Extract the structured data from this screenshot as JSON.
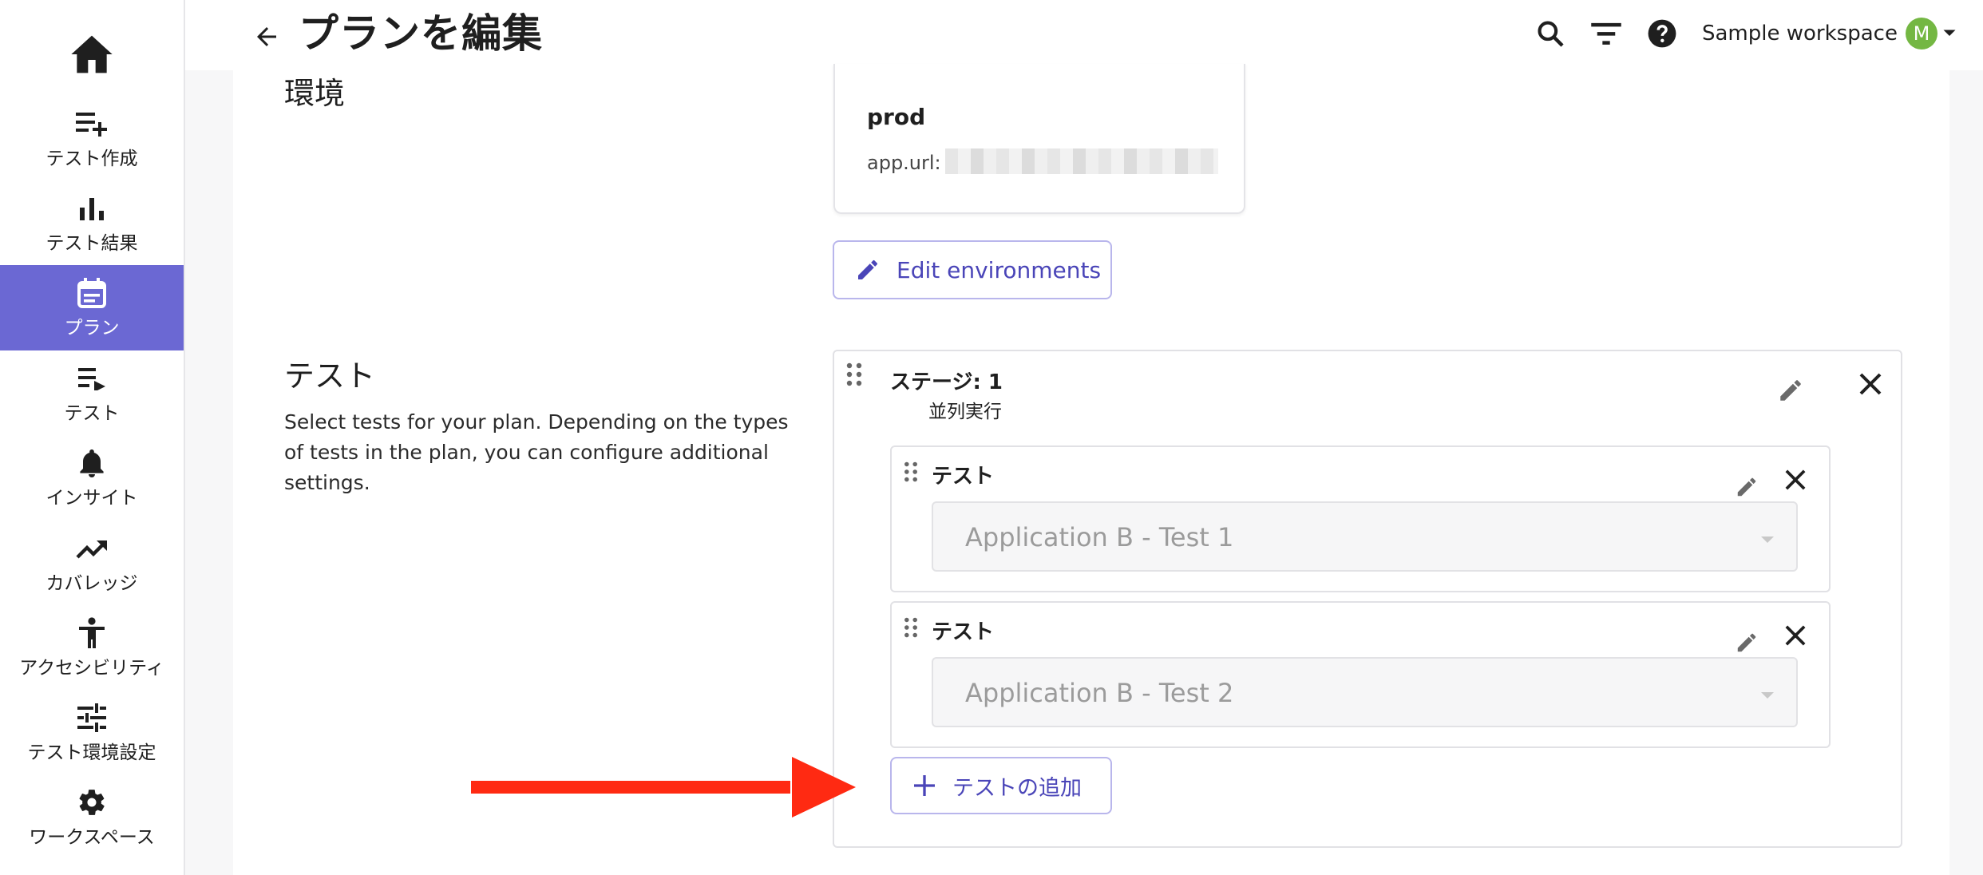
{
  "sidebar": {
    "items": [
      {
        "label": "テスト作成",
        "icon": "playlist-add-icon"
      },
      {
        "label": "テスト結果",
        "icon": "bar-chart-icon"
      },
      {
        "label": "プラン",
        "icon": "calendar-icon",
        "active": true
      },
      {
        "label": "テスト",
        "icon": "playlist-play-icon"
      },
      {
        "label": "インサイト",
        "icon": "bell-icon"
      },
      {
        "label": "カバレッジ",
        "icon": "trending-up-icon"
      },
      {
        "label": "アクセシビリティ",
        "icon": "accessibility-icon"
      },
      {
        "label": "テスト環境設定",
        "icon": "tune-icon"
      },
      {
        "label": "ワークスペース",
        "icon": "gear-icon"
      }
    ]
  },
  "header": {
    "title": "プランを編集",
    "workspace": "Sample workspace",
    "avatar_initial": "M"
  },
  "environment": {
    "section_title": "環境",
    "env_name": "prod",
    "url_label": "app.url:",
    "edit_button": "Edit environments"
  },
  "tests_section": {
    "section_title": "テスト",
    "description": "Select tests for your plan. Depending on the types of tests in the plan, you can configure additional settings.",
    "stage": {
      "title": "ステージ: 1",
      "subtitle": "並列実行",
      "tests": [
        {
          "label": "テスト",
          "selected": "Application B - Test 1"
        },
        {
          "label": "テスト",
          "selected": "Application B - Test 2"
        }
      ]
    },
    "add_button": "テストの追加"
  },
  "colors": {
    "accent": "#6b68d3",
    "button_text": "#4a45b8",
    "annotation_arrow": "#ff2a12",
    "avatar": "#74b743"
  }
}
